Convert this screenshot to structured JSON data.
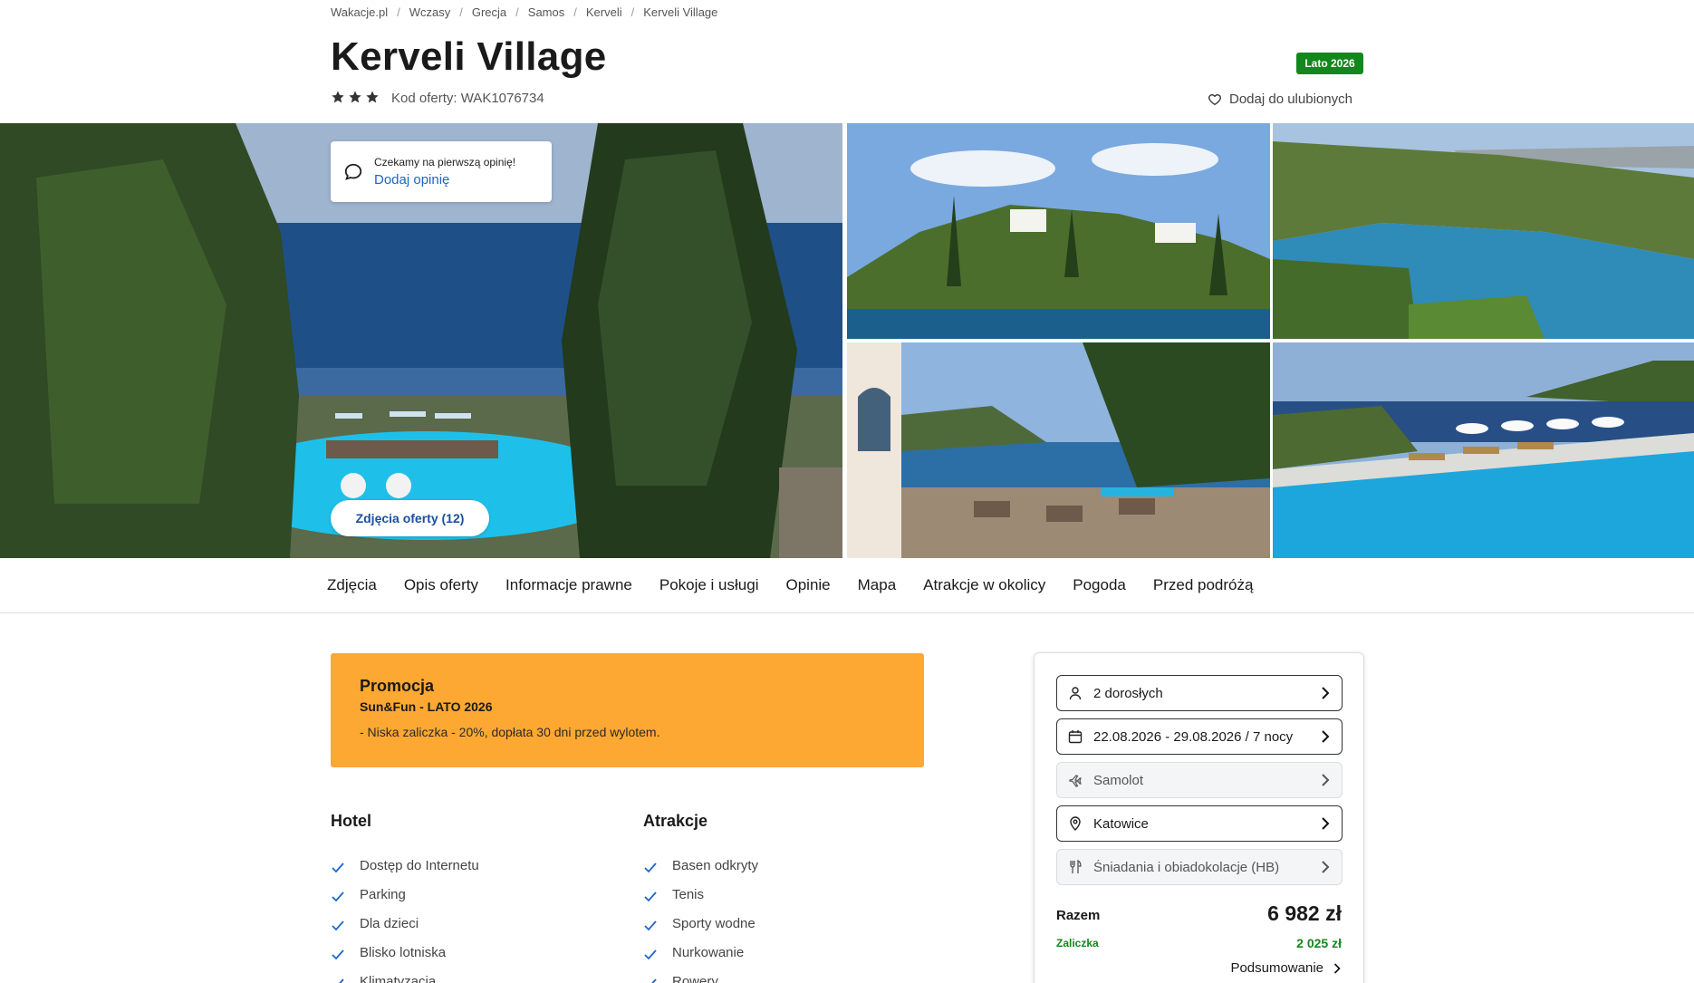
{
  "breadcrumb": [
    "Wakacje.pl",
    "Wczasy",
    "Grecja",
    "Samos",
    "Kerveli",
    "Kerveli Village"
  ],
  "hotel": {
    "name": "Kerveli Village",
    "stars": 3,
    "offer_code": "Kod oferty: WAK1076734",
    "season_badge": "Lato 2026",
    "favorite_label": "Dodaj do ulubionych"
  },
  "gallery": {
    "review_prompt": "Czekamy na pierwszą opinię!",
    "add_review": "Dodaj opinię",
    "photos_button": "Zdjęcia oferty (12)"
  },
  "tabs": [
    "Zdjęcia",
    "Opis oferty",
    "Informacje prawne",
    "Pokoje i usługi",
    "Opinie",
    "Mapa",
    "Atrakcje w okolicy",
    "Pogoda",
    "Przed podróżą"
  ],
  "promo": {
    "title": "Promocja",
    "subtitle": "Sun&Fun - LATO 2026",
    "description": "- Niska zaliczka - 20%, dopłata 30 dni przed wylotem."
  },
  "amenities": {
    "hotel": {
      "title": "Hotel",
      "items": [
        "Dostęp do Internetu",
        "Parking",
        "Dla dzieci",
        "Blisko lotniska",
        "Klimatyzacja"
      ]
    },
    "attractions": {
      "title": "Atrakcje",
      "items": [
        "Basen odkryty",
        "Tenis",
        "Sporty wodne",
        "Nurkowanie",
        "Rowery"
      ]
    }
  },
  "booking": {
    "travelers": "2 dorosłych",
    "dates": "22.08.2026 - 29.08.2026 / 7 nocy",
    "transport": "Samolot",
    "departure": "Katowice",
    "board": "Śniadania i obiadokolacje (HB)",
    "total_label": "Razem",
    "total_value": "6 982 zł",
    "deposit_label": "Zaliczka",
    "deposit_value": "2 025 zł",
    "summary_link": "Podsumowanie"
  },
  "colors": {
    "season_badge": "#14871c",
    "promo_bg": "#fca833",
    "link_blue": "#1b66c9",
    "deposit_green": "#14871c"
  }
}
